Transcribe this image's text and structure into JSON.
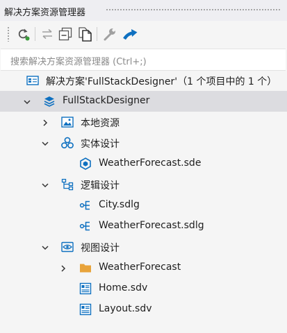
{
  "panel": {
    "title": "解决方案资源管理器"
  },
  "toolbar": {
    "buttons": [
      {
        "name": "refresh-button",
        "icon": "refresh-icon"
      },
      {
        "name": "sync-button",
        "icon": "sync-arrows-icon"
      },
      {
        "name": "collapse-all-button",
        "icon": "collapse-all-icon"
      },
      {
        "name": "show-all-files-button",
        "icon": "copy-files-icon"
      },
      {
        "name": "properties-button",
        "icon": "wrench-icon"
      },
      {
        "name": "navigate-button",
        "icon": "curved-arrow-icon"
      }
    ]
  },
  "search": {
    "placeholder": "搜索解决方案资源管理器 (Ctrl+;)"
  },
  "tree": {
    "solution": {
      "label": "解决方案'FullStackDesigner'（1 个项目中的 1 个）"
    },
    "project": {
      "label": "FullStackDesigner"
    },
    "local_resources": {
      "label": "本地资源"
    },
    "entity_design": {
      "label": "实体设计"
    },
    "entity_file": {
      "label": "WeatherForecast.sde"
    },
    "logic_design": {
      "label": "逻辑设计"
    },
    "logic_file_1": {
      "label": "City.sdlg"
    },
    "logic_file_2": {
      "label": "WeatherForecast.sdlg"
    },
    "view_design": {
      "label": "视图设计"
    },
    "view_folder": {
      "label": "WeatherForecast"
    },
    "view_file_1": {
      "label": "Home.sdv"
    },
    "view_file_2": {
      "label": "Layout.sdv"
    }
  },
  "colors": {
    "accent": "#0e70c0",
    "selected_row": "#dcdce0",
    "folder": "#e8a33a",
    "refresh_dot": "#3a9a3a",
    "background": "#f5f5f5"
  }
}
